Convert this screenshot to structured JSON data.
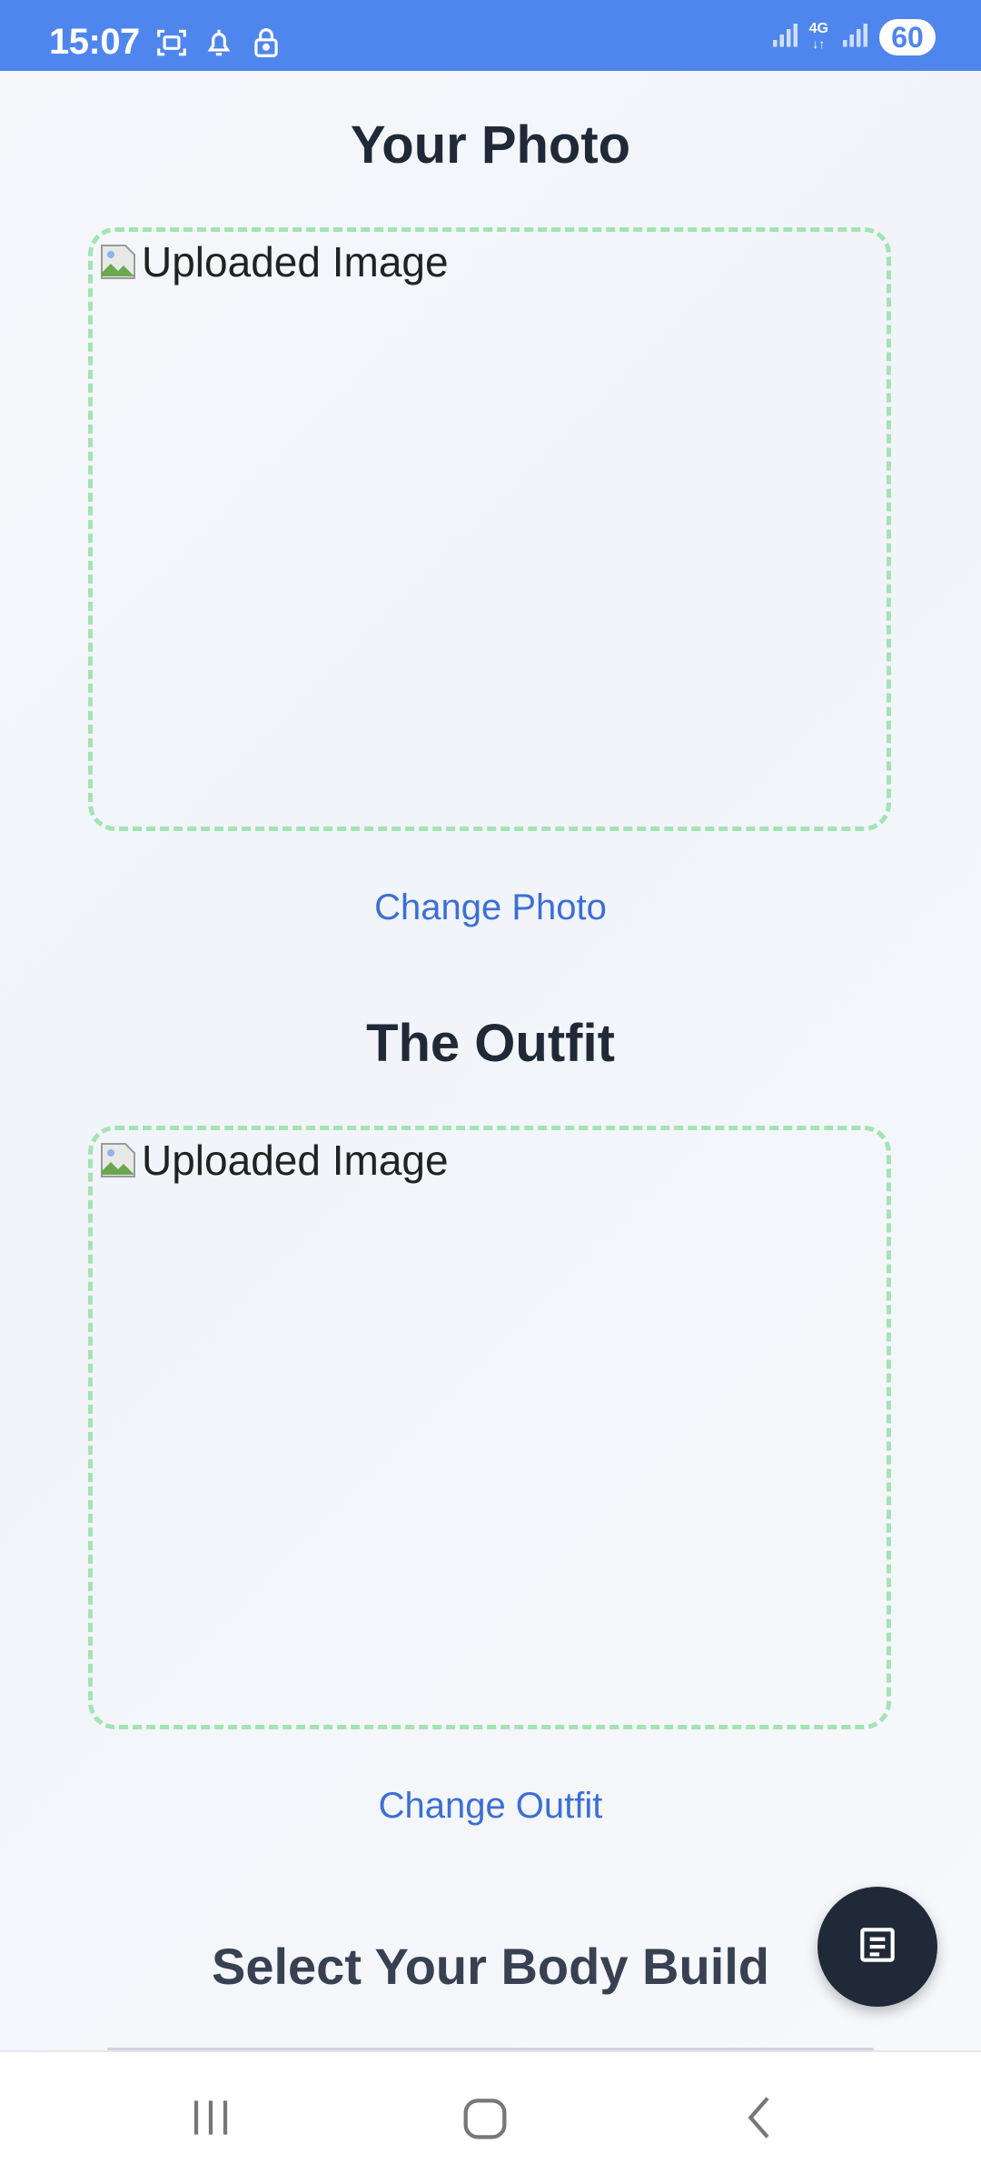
{
  "status_bar": {
    "time": "15:07",
    "network": "4G",
    "battery": "60",
    "bg_color": "#4f86ee"
  },
  "sections": {
    "photo": {
      "title": "Your Photo",
      "image_alt": "Uploaded Image",
      "change_label": "Change Photo"
    },
    "outfit": {
      "title": "The Outfit",
      "image_alt": "Uploaded Image",
      "change_label": "Change Outfit"
    },
    "body_build": {
      "title": "Select Your Body Build"
    }
  },
  "fab": {
    "icon": "document-icon"
  },
  "nav": {
    "recent_icon": "recent-apps-icon",
    "home_icon": "home-icon",
    "back_icon": "back-icon"
  },
  "colors": {
    "accent": "#3b6fd6",
    "dashed_border": "#a3e4b2",
    "title": "#1f2937",
    "fab": "#1f2937"
  }
}
